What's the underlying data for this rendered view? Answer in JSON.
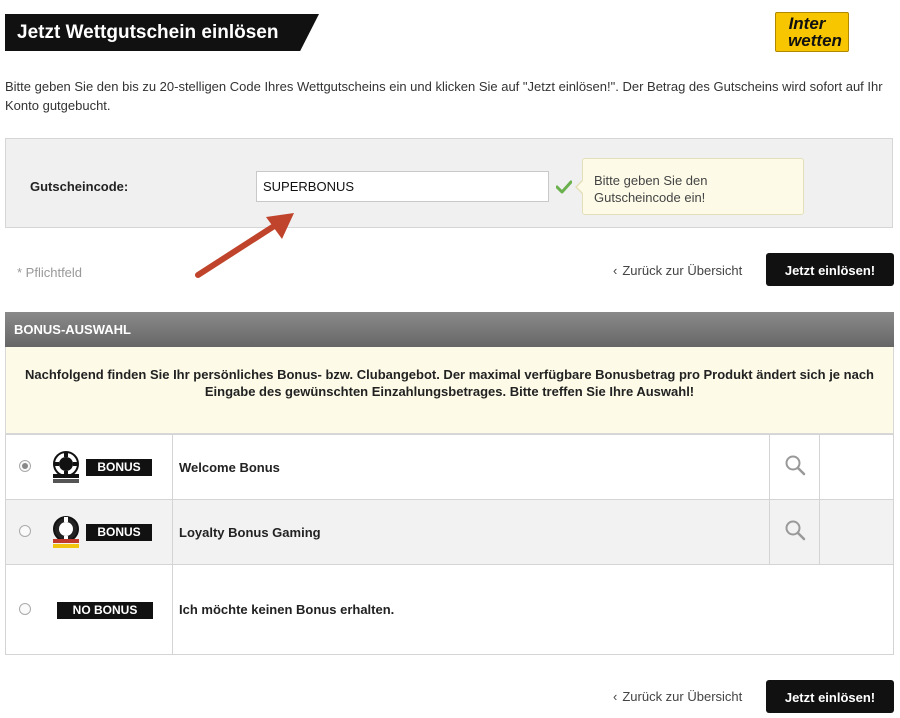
{
  "header": {
    "title": "Jetzt Wettgutschein einlösen",
    "logo_line1": "Inter",
    "logo_line2": "wetten"
  },
  "intro_text": "Bitte geben Sie den bis zu 20-stelligen Code Ihres Wettgutscheins ein und klicken Sie auf \"Jetzt einlösen!\". Der Betrag des Gutscheins wird sofort auf Ihr Konto gutgebucht.",
  "form": {
    "code_label": "Gutscheincode:",
    "code_value": "SUPERBONUS",
    "tooltip_text": "Bitte geben Sie den Gutscheincode ein!"
  },
  "required_note": "* Pflichtfeld",
  "actions": {
    "back_label": "Zurück zur Übersicht",
    "submit_label": "Jetzt einlösen!"
  },
  "bonus_section": {
    "header": "BONUS-AUSWAHL",
    "notice": "Nachfolgend finden Sie Ihr persönliches Bonus- bzw. Clubangebot. Der maximal verfügbare Bonusbetrag pro Produkt ändert sich je nach Eingabe des gewünschten Einzahlungsbetrages. Bitte treffen Sie Ihre Auswahl!",
    "options": [
      {
        "badge": "BONUS",
        "name": "Welcome Bonus",
        "selected": true
      },
      {
        "badge": "BONUS",
        "name": "Loyalty Bonus Gaming",
        "selected": false
      },
      {
        "badge": "NO BONUS",
        "name": "Ich möchte keinen Bonus erhalten.",
        "selected": false
      }
    ]
  },
  "colors": {
    "accent_dark": "#111111",
    "logo_yellow": "#f7c600",
    "notice_bg": "#fdfbe8",
    "check_green": "#6ab04c",
    "arrow_red": "#c0442b"
  }
}
